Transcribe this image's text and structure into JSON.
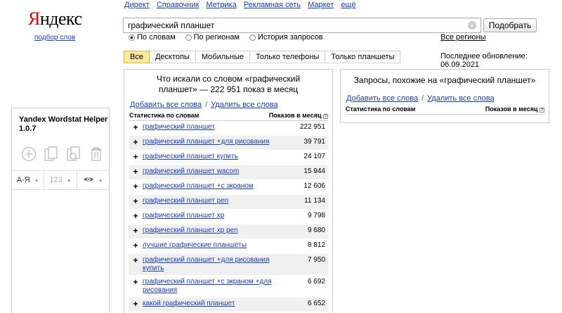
{
  "logo": {
    "brand_first": "Я",
    "brand_rest": "ндекс",
    "sub": "подбор слов"
  },
  "topnav": [
    "Директ",
    "Справочник",
    "Метрика",
    "Рекламная сеть",
    "Маркет",
    "ещё"
  ],
  "search": {
    "value": "графический планшет",
    "button": "Подобрать"
  },
  "radios": [
    {
      "label": "По словам",
      "selected": true
    },
    {
      "label": "По регионам",
      "selected": false
    },
    {
      "label": "История запросов",
      "selected": false
    }
  ],
  "regions_link": "Все регионы",
  "tabs": [
    "Все",
    "Десктопы",
    "Мобильные",
    "Только телефоны",
    "Только планшеты"
  ],
  "updated": "Последнее обновление: 06.09.2021",
  "left_panel": {
    "title_line1": "Что искали со словом «графический",
    "title_line2": "планшет» — 222 951 показ в месяц",
    "add_all": "Добавить все слова",
    "remove_all": "Удалить все слова",
    "col_stat": "Статистика по словам",
    "col_shows": "Показов в месяц",
    "rows": [
      {
        "kw": "графический планшет",
        "count": "222 951"
      },
      {
        "kw": "графический планшет +для рисования",
        "count": "39 791"
      },
      {
        "kw": "графический планшет купить",
        "count": "24 107"
      },
      {
        "kw": "графический планшет wacom",
        "count": "15 944"
      },
      {
        "kw": "графический планшет +с экраном",
        "count": "12 606"
      },
      {
        "kw": "графический планшет pen",
        "count": "11 134"
      },
      {
        "kw": "графический планшет xp",
        "count": "9 798"
      },
      {
        "kw": "графический планшет xp pen",
        "count": "9 680"
      },
      {
        "kw": "лучшие графические планшеты",
        "count": "8 812"
      },
      {
        "kw": "графический планшет +для рисования купить",
        "count": "7 950"
      },
      {
        "kw": "графический планшет +с экраном +для рисования",
        "count": "6 692"
      },
      {
        "kw": "какой графический планшет",
        "count": "6 652"
      }
    ]
  },
  "right_panel": {
    "title": "Запросы, похожие на «графический планшет»",
    "add_all": "Добавить все слова",
    "remove_all": "Удалить все слова",
    "col_stat": "Статистика по словам",
    "col_shows": "Показов в месяц"
  },
  "helper": {
    "title_line1": "Yandex Wordstat Helper",
    "title_line2": "1.0.7",
    "sort_az": "А-Я",
    "sort_num": "123",
    "icons": [
      "add-circle-icon",
      "copy-icon",
      "copy-settings-icon",
      "trash-icon",
      "eye-icon"
    ]
  }
}
